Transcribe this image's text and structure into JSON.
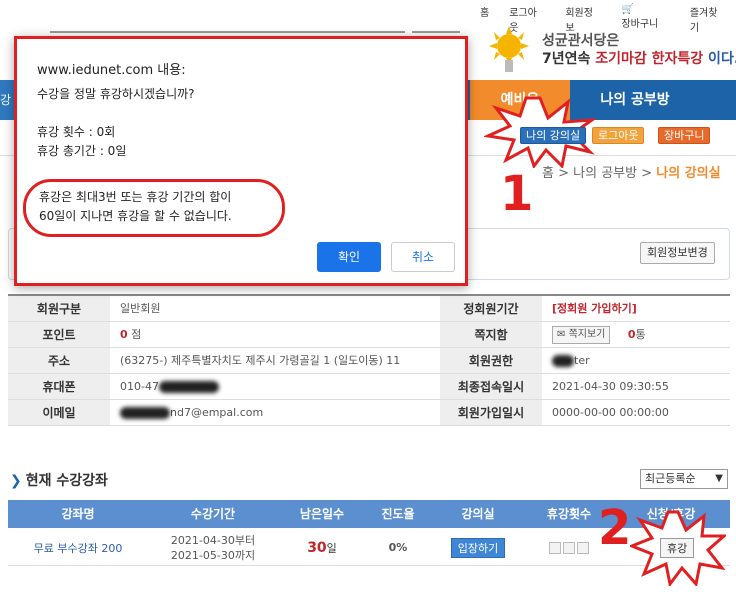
{
  "toplinks": [
    "홈",
    "로그아웃",
    "회원정보",
    "장바구니",
    "즐겨찾기"
  ],
  "banner": {
    "line1": "성균관서당은",
    "line2_prefix": "7년연속 ",
    "line2_red": "조기마감 한자특강",
    "line2_suffix": " 이다."
  },
  "nav": {
    "left_tab": "강좌",
    "orange_tab": "예비은",
    "study_tab": "나의 공부방"
  },
  "mini_buttons": {
    "my_class": "나의 강의실",
    "logout": "로그아웃",
    "cart": "장바구니"
  },
  "breadcrumb": {
    "home": "홈",
    "parent": "나의 공부방",
    "sep": " > ",
    "current": "나의 강의실"
  },
  "member_edit_button": "회원정보변경",
  "info": {
    "type_label": "회원구분",
    "type_value": "일반회원",
    "period_label": "정회원기간",
    "period_value": "[정회원 가입하기]",
    "point_label": "포인트",
    "point_value": "0",
    "point_unit": "점",
    "msg_label": "쪽지함",
    "msg_button": "쪽지보기",
    "msg_count": "0",
    "msg_unit": "통",
    "addr_label": "주소",
    "addr_value": "(63275-) 제주특별자치도 제주시 가령골길 1 (일도이동) 11",
    "auth_label": "회원권한",
    "auth_value": "ter",
    "phone_label": "휴대폰",
    "phone_value": "010-47",
    "last_label": "최종접속일시",
    "last_value": "2021-04-30 09:30:55",
    "email_label": "이메일",
    "email_value": "nd7@empal.com",
    "join_label": "회원가입일시",
    "join_value": "0000-00-00 00:00:00"
  },
  "courses": {
    "title": "현재 수강강좌",
    "sort": "최근등록순",
    "headers": [
      "강좌명",
      "수강기간",
      "남은일수",
      "진도율",
      "강의실",
      "휴강횟수",
      "신청/휴강"
    ],
    "rows": [
      {
        "name": "무료 부수강좌 200",
        "period_from": "2021-04-30부터",
        "period_to": "2021-05-30까지",
        "days": "30",
        "days_unit": "일",
        "progress": "0%",
        "enter": "입장하기",
        "leave": "휴강"
      }
    ]
  },
  "dialog": {
    "title": "www.iedunet.com 내용:",
    "message": "수강을 정말 휴강하시겠습니까?\n\n휴강 횟수 : 0회\n휴강 총기간 : 0일",
    "note": "휴강은 최대3번 또는 휴강 기간의 합이\n60일이 지나면 휴강을 할 수 없습니다.",
    "ok": "확인",
    "cancel": "취소"
  },
  "annotations": {
    "one": "1",
    "two": "2"
  },
  "colors": {
    "nav": "#1c63a8",
    "accent": "#f28b2c",
    "highlight": "#e02020"
  }
}
